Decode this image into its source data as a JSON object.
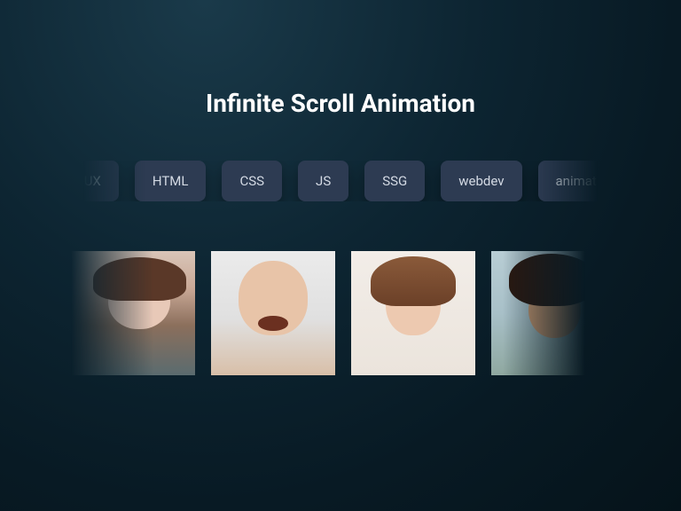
{
  "title": "Infinite Scroll Animation",
  "tags": [
    "UI/UX",
    "HTML",
    "CSS",
    "JS",
    "SSG",
    "webdev",
    "animation"
  ],
  "images": [
    {
      "alt": "portrait-1"
    },
    {
      "alt": "portrait-2"
    },
    {
      "alt": "portrait-3"
    },
    {
      "alt": "portrait-4"
    }
  ]
}
